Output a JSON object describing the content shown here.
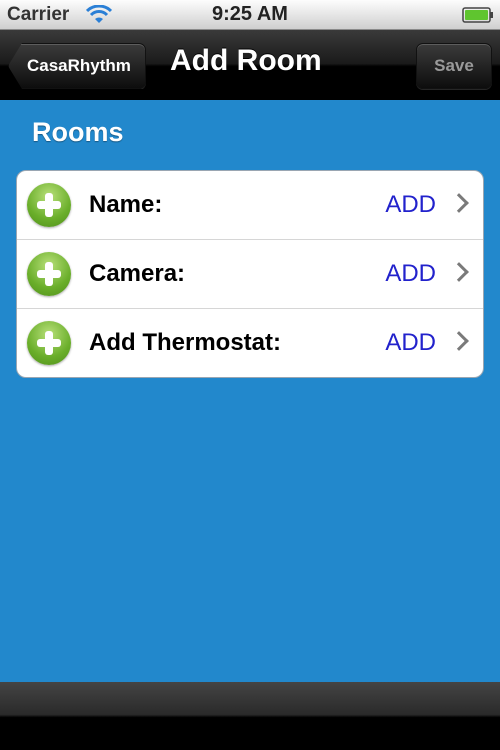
{
  "status_bar": {
    "carrier": "Carrier",
    "time": "9:25 AM",
    "wifi_icon": "wifi-icon",
    "battery_icon": "battery-icon",
    "battery_color": "#5fc52f"
  },
  "nav": {
    "back_label": "CasaRhythm",
    "title": "Add Room",
    "save_label": "Save"
  },
  "section": {
    "header": "Rooms",
    "rows": [
      {
        "label": "Name:",
        "value": "ADD",
        "icon": "add-icon",
        "accessory": "chevron-right-icon"
      },
      {
        "label": "Camera:",
        "value": "ADD",
        "icon": "add-icon",
        "accessory": "chevron-right-icon"
      },
      {
        "label": "Add Thermostat:",
        "value": "ADD",
        "icon": "add-icon",
        "accessory": "chevron-right-icon"
      }
    ]
  },
  "colors": {
    "background": "#2288cc",
    "value_text": "#2222cc",
    "add_icon": "#6aae2a"
  }
}
